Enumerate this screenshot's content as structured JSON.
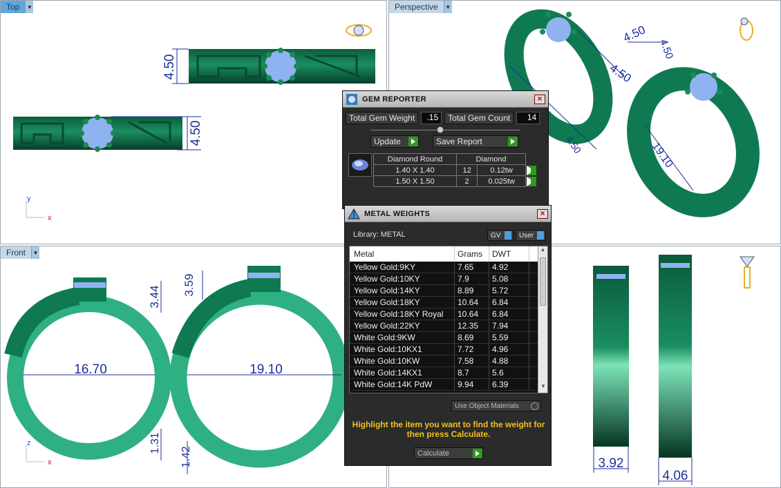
{
  "viewports": {
    "top": {
      "label": "Top",
      "dims": [
        "4.50",
        "4.50"
      ],
      "axes": {
        "a": "y",
        "b": "x"
      }
    },
    "perspective": {
      "label": "Perspective",
      "dims": [
        "4.50",
        "4.50",
        "4.50",
        "4.50",
        "19.10"
      ]
    },
    "front": {
      "label": "Front",
      "dims": [
        "3.44",
        "3.59",
        "16.70",
        "19.10",
        "1.31",
        "1.42"
      ],
      "axes": {
        "a": "z",
        "b": "x"
      }
    },
    "right": {
      "dims": [
        "3.92",
        "4.06"
      ]
    }
  },
  "gem_reporter": {
    "title": "GEM REPORTER",
    "total_weight_label": "Total Gem Weight",
    "total_weight_value": ".15",
    "total_count_label": "Total Gem Count",
    "total_count_value": "14",
    "update_label": "Update",
    "save_label": "Save Report",
    "table_headers": [
      "Diamond Round",
      "Diamond"
    ],
    "rows": [
      {
        "size": "1.40 X 1.40",
        "count": "12",
        "weight": "0.12tw"
      },
      {
        "size": "1.50 X 1.50",
        "count": "2",
        "weight": "0.025tw"
      }
    ]
  },
  "metal_weights": {
    "title": "METAL WEIGHTS",
    "library_label": "Library: METAL",
    "gv_label": "GV",
    "user_label": "User",
    "columns": [
      "Metal",
      "Grams",
      "DWT"
    ],
    "rows": [
      {
        "metal": "Yellow Gold:9KY",
        "grams": "7.65",
        "dwt": "4.92"
      },
      {
        "metal": "Yellow Gold:10KY",
        "grams": "7.9",
        "dwt": "5.08"
      },
      {
        "metal": "Yellow Gold:14KY",
        "grams": "8.89",
        "dwt": "5.72"
      },
      {
        "metal": "Yellow Gold:18KY",
        "grams": "10.64",
        "dwt": "6.84"
      },
      {
        "metal": "Yellow Gold:18KY Royal",
        "grams": "10.64",
        "dwt": "6.84"
      },
      {
        "metal": "Yellow Gold:22KY",
        "grams": "12.35",
        "dwt": "7.94"
      },
      {
        "metal": "White Gold:9KW",
        "grams": "8.69",
        "dwt": "5.59"
      },
      {
        "metal": "White Gold:10KX1",
        "grams": "7.72",
        "dwt": "4.96"
      },
      {
        "metal": "White Gold:10KW",
        "grams": "7.58",
        "dwt": "4.88"
      },
      {
        "metal": "White Gold:14KX1",
        "grams": "8.7",
        "dwt": "5.6"
      },
      {
        "metal": "White Gold:14K PdW",
        "grams": "9.94",
        "dwt": "6.39"
      }
    ],
    "use_object_materials_label": "Use Object Materials",
    "hint": "Highlight the item you want to find the weight for then press Calculate.",
    "calculate_label": "Calculate"
  },
  "colors": {
    "ring": "#0f7a52",
    "ring_light": "#2fb082",
    "dim": "#1a2f9a",
    "gem": "#8fb2f0"
  }
}
